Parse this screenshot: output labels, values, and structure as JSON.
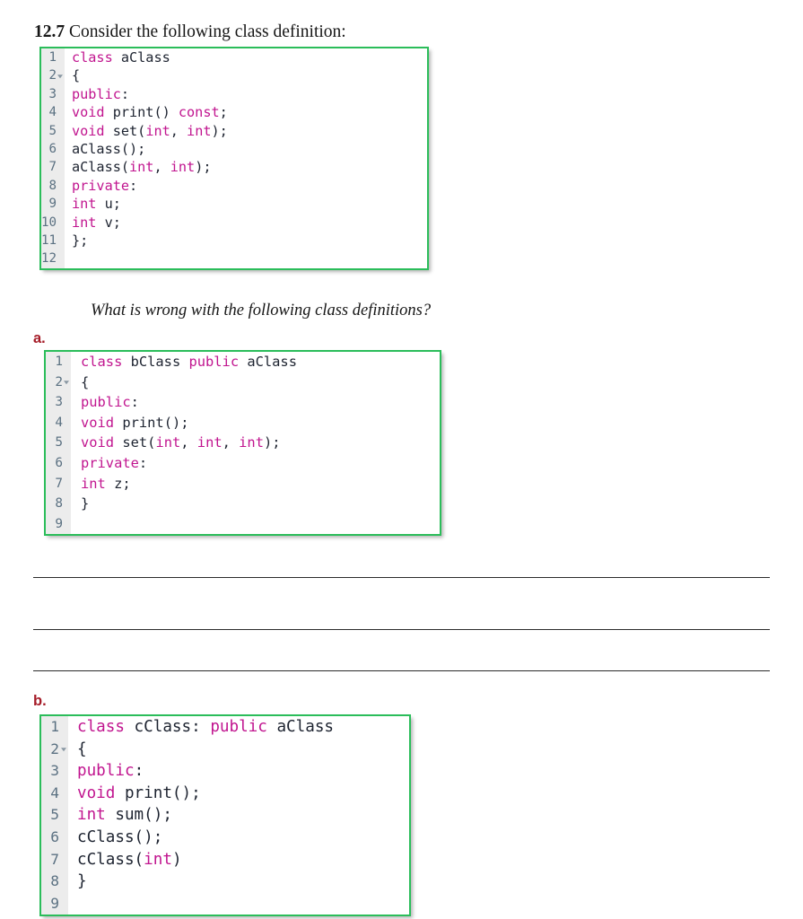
{
  "document": {
    "exercise_number": "12.7",
    "heading_text": "Consider the following class definition:",
    "prompt": "What is wrong with the following class definitions?",
    "part_a_label": "a.",
    "part_b_label": "b.",
    "accent_color": "#2bbd5a",
    "label_color": "#a51c28",
    "keyword_color": "#c1158f",
    "gutter_color": "#ececec",
    "line_number_color": "#5b7182"
  },
  "code_block_1": {
    "name": "aClass definition",
    "line_count": 12,
    "lines": [
      {
        "number": "1",
        "fold": false,
        "tokens": [
          {
            "t": "class",
            "c": "kw"
          },
          {
            "t": " ",
            "c": "pun"
          },
          {
            "t": "aClass",
            "c": "id"
          }
        ]
      },
      {
        "number": "2",
        "fold": true,
        "tokens": [
          {
            "t": "{",
            "c": "pun"
          }
        ]
      },
      {
        "number": "3",
        "fold": false,
        "tokens": [
          {
            "t": "public",
            "c": "kw"
          },
          {
            "t": ":",
            "c": "pun"
          }
        ]
      },
      {
        "number": "4",
        "fold": false,
        "tokens": [
          {
            "t": "void",
            "c": "kw"
          },
          {
            "t": " ",
            "c": "pun"
          },
          {
            "t": "print() ",
            "c": "id"
          },
          {
            "t": "const",
            "c": "kw"
          },
          {
            "t": ";",
            "c": "pun"
          }
        ]
      },
      {
        "number": "5",
        "fold": false,
        "tokens": [
          {
            "t": "void",
            "c": "kw"
          },
          {
            "t": " ",
            "c": "pun"
          },
          {
            "t": "set(",
            "c": "id"
          },
          {
            "t": "int",
            "c": "kw"
          },
          {
            "t": ", ",
            "c": "pun"
          },
          {
            "t": "int",
            "c": "kw"
          },
          {
            "t": ");",
            "c": "pun"
          }
        ]
      },
      {
        "number": "6",
        "fold": false,
        "tokens": [
          {
            "t": "aClass();",
            "c": "id"
          }
        ]
      },
      {
        "number": "7",
        "fold": false,
        "tokens": [
          {
            "t": "aClass(",
            "c": "id"
          },
          {
            "t": "int",
            "c": "kw"
          },
          {
            "t": ", ",
            "c": "pun"
          },
          {
            "t": "int",
            "c": "kw"
          },
          {
            "t": ");",
            "c": "pun"
          }
        ]
      },
      {
        "number": "8",
        "fold": false,
        "tokens": [
          {
            "t": "private",
            "c": "kw"
          },
          {
            "t": ":",
            "c": "pun"
          }
        ]
      },
      {
        "number": "9",
        "fold": false,
        "tokens": [
          {
            "t": "int",
            "c": "kw"
          },
          {
            "t": " u;",
            "c": "id"
          }
        ]
      },
      {
        "number": "10",
        "fold": false,
        "tokens": [
          {
            "t": "int",
            "c": "kw"
          },
          {
            "t": " v;",
            "c": "id"
          }
        ]
      },
      {
        "number": "11",
        "fold": false,
        "tokens": [
          {
            "t": "};",
            "c": "pun"
          }
        ]
      },
      {
        "number": "12",
        "fold": false,
        "tokens": []
      }
    ]
  },
  "code_block_a": {
    "name": "bClass definition",
    "line_count": 9,
    "lines": [
      {
        "number": "1",
        "fold": false,
        "tokens": [
          {
            "t": "class",
            "c": "kw"
          },
          {
            "t": " bClass ",
            "c": "id"
          },
          {
            "t": "public",
            "c": "kw"
          },
          {
            "t": " aClass",
            "c": "id"
          }
        ]
      },
      {
        "number": "2",
        "fold": true,
        "tokens": [
          {
            "t": "{",
            "c": "pun"
          }
        ]
      },
      {
        "number": "3",
        "fold": false,
        "tokens": [
          {
            "t": "public",
            "c": "kw"
          },
          {
            "t": ":",
            "c": "pun"
          }
        ]
      },
      {
        "number": "4",
        "fold": false,
        "tokens": [
          {
            "t": "void",
            "c": "kw"
          },
          {
            "t": " ",
            "c": "pun"
          },
          {
            "t": "print();",
            "c": "id"
          }
        ]
      },
      {
        "number": "5",
        "fold": false,
        "tokens": [
          {
            "t": "void",
            "c": "kw"
          },
          {
            "t": " ",
            "c": "pun"
          },
          {
            "t": "set(",
            "c": "id"
          },
          {
            "t": "int",
            "c": "kw"
          },
          {
            "t": ", ",
            "c": "pun"
          },
          {
            "t": "int",
            "c": "kw"
          },
          {
            "t": ", ",
            "c": "pun"
          },
          {
            "t": "int",
            "c": "kw"
          },
          {
            "t": ");",
            "c": "pun"
          }
        ]
      },
      {
        "number": "6",
        "fold": false,
        "tokens": [
          {
            "t": "private",
            "c": "kw"
          },
          {
            "t": ":",
            "c": "pun"
          }
        ]
      },
      {
        "number": "7",
        "fold": false,
        "tokens": [
          {
            "t": "int",
            "c": "kw"
          },
          {
            "t": " z;",
            "c": "id"
          }
        ]
      },
      {
        "number": "8",
        "fold": false,
        "tokens": [
          {
            "t": "}",
            "c": "pun"
          }
        ]
      },
      {
        "number": "9",
        "fold": false,
        "tokens": []
      }
    ]
  },
  "code_block_b": {
    "name": "cClass definition",
    "line_count": 9,
    "lines": [
      {
        "number": "1",
        "fold": false,
        "tokens": [
          {
            "t": "class",
            "c": "kw"
          },
          {
            "t": " cClass: ",
            "c": "id"
          },
          {
            "t": "public",
            "c": "kw"
          },
          {
            "t": " aClass",
            "c": "id"
          }
        ]
      },
      {
        "number": "2",
        "fold": true,
        "tokens": [
          {
            "t": "{",
            "c": "pun"
          }
        ]
      },
      {
        "number": "3",
        "fold": false,
        "tokens": [
          {
            "t": "public",
            "c": "kw"
          },
          {
            "t": ":",
            "c": "pun"
          }
        ]
      },
      {
        "number": "4",
        "fold": false,
        "tokens": [
          {
            "t": "void",
            "c": "kw"
          },
          {
            "t": " ",
            "c": "pun"
          },
          {
            "t": "print();",
            "c": "id"
          }
        ]
      },
      {
        "number": "5",
        "fold": false,
        "tokens": [
          {
            "t": "int",
            "c": "kw"
          },
          {
            "t": " ",
            "c": "pun"
          },
          {
            "t": "sum();",
            "c": "id"
          }
        ]
      },
      {
        "number": "6",
        "fold": false,
        "tokens": [
          {
            "t": "cClass();",
            "c": "id"
          }
        ]
      },
      {
        "number": "7",
        "fold": false,
        "tokens": [
          {
            "t": "cClass(",
            "c": "id"
          },
          {
            "t": "int",
            "c": "kw"
          },
          {
            "t": ")",
            "c": "pun"
          }
        ]
      },
      {
        "number": "8",
        "fold": false,
        "tokens": [
          {
            "t": "}",
            "c": "pun"
          }
        ]
      },
      {
        "number": "9",
        "fold": false,
        "tokens": []
      }
    ]
  },
  "answer_rules": [
    {
      "id": "answer-rule-1"
    },
    {
      "id": "answer-rule-2"
    },
    {
      "id": "answer-rule-3"
    }
  ]
}
